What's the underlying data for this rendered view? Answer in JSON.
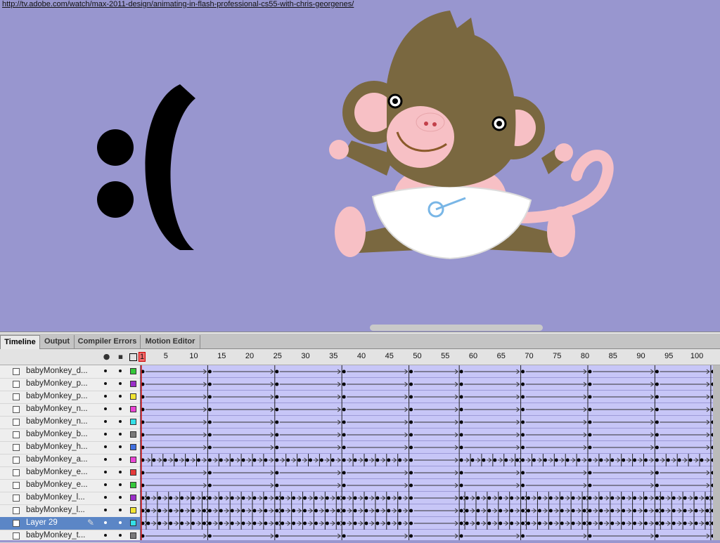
{
  "url": "http://tv.adobe.com/watch/max-2011-design/animating-in-flash-professional-cs55-with-chris-georgenes/",
  "stage": {
    "background": "#9896cf",
    "emoticon": ":("
  },
  "tabs": [
    {
      "label": "Timeline",
      "active": true
    },
    {
      "label": "Output",
      "active": false
    },
    {
      "label": "Compiler Errors",
      "active": false
    },
    {
      "label": "Motion Editor",
      "active": false
    }
  ],
  "header_icons": [
    "eye-icon",
    "lock-icon",
    "outline-icon"
  ],
  "ruler": {
    "first_frame": "1",
    "ticks": [
      "5",
      "10",
      "15",
      "20",
      "25",
      "30",
      "35",
      "40",
      "45",
      "50",
      "55",
      "60",
      "65",
      "70",
      "75",
      "80",
      "85",
      "90",
      "95",
      "100"
    ],
    "current_frame": 1,
    "visible_frames": 103
  },
  "layers": [
    {
      "name": "babyMonkey_d...",
      "color": "#34c83a",
      "selected": false,
      "pattern": "tween"
    },
    {
      "name": "babyMonkey_p...",
      "color": "#9b2fc9",
      "selected": false,
      "pattern": "tween"
    },
    {
      "name": "babyMonkey_p...",
      "color": "#f2e533",
      "selected": false,
      "pattern": "tween"
    },
    {
      "name": "babyMonkey_n...",
      "color": "#ea45d6",
      "selected": false,
      "pattern": "tween"
    },
    {
      "name": "babyMonkey_n...",
      "color": "#34e0e8",
      "selected": false,
      "pattern": "tween"
    },
    {
      "name": "babyMonkey_b...",
      "color": "#7a7a7a",
      "selected": false,
      "pattern": "tween"
    },
    {
      "name": "babyMonkey_h...",
      "color": "#3f6fe0",
      "selected": false,
      "pattern": "tween"
    },
    {
      "name": "babyMonkey_a...",
      "color": "#ea45d6",
      "selected": false,
      "pattern": "dense"
    },
    {
      "name": "babyMonkey_e...",
      "color": "#e53a3a",
      "selected": false,
      "pattern": "tween"
    },
    {
      "name": "babyMonkey_e...",
      "color": "#34c83a",
      "selected": false,
      "pattern": "tween"
    },
    {
      "name": "babyMonkey_l...",
      "color": "#9b2fc9",
      "selected": false,
      "pattern": "keys"
    },
    {
      "name": "babyMonkey_l...",
      "color": "#f2e533",
      "selected": false,
      "pattern": "keys"
    },
    {
      "name": "Layer 29",
      "color": "#34e0e8",
      "selected": true,
      "pattern": "keys"
    },
    {
      "name": "babyMonkey_t...",
      "color": "#7a7a7a",
      "selected": false,
      "pattern": "tween"
    }
  ],
  "keyframes": {
    "tween": [
      1,
      13,
      25,
      37,
      49,
      58,
      69,
      81,
      93,
      103
    ],
    "dense": [
      1,
      3,
      5,
      7,
      9,
      11,
      13,
      15,
      17,
      19,
      21,
      23,
      25,
      27,
      29,
      31,
      33,
      35,
      37,
      39,
      41,
      43,
      45,
      47,
      49,
      58,
      60,
      62,
      64,
      66,
      68,
      69,
      71,
      73,
      75,
      77,
      79,
      81,
      83,
      85,
      87,
      89,
      91,
      93,
      95,
      97,
      99,
      101,
      103
    ],
    "keys": [
      1,
      2,
      4,
      6,
      8,
      10,
      12,
      13,
      15,
      17,
      19,
      21,
      23,
      25,
      26,
      28,
      30,
      32,
      34,
      36,
      37,
      39,
      41,
      43,
      45,
      47,
      49,
      58,
      59,
      61,
      63,
      65,
      67,
      69,
      70,
      72,
      74,
      76,
      78,
      80,
      81,
      83,
      85,
      87,
      89,
      91,
      93,
      94,
      96,
      98,
      100,
      102,
      103
    ]
  }
}
